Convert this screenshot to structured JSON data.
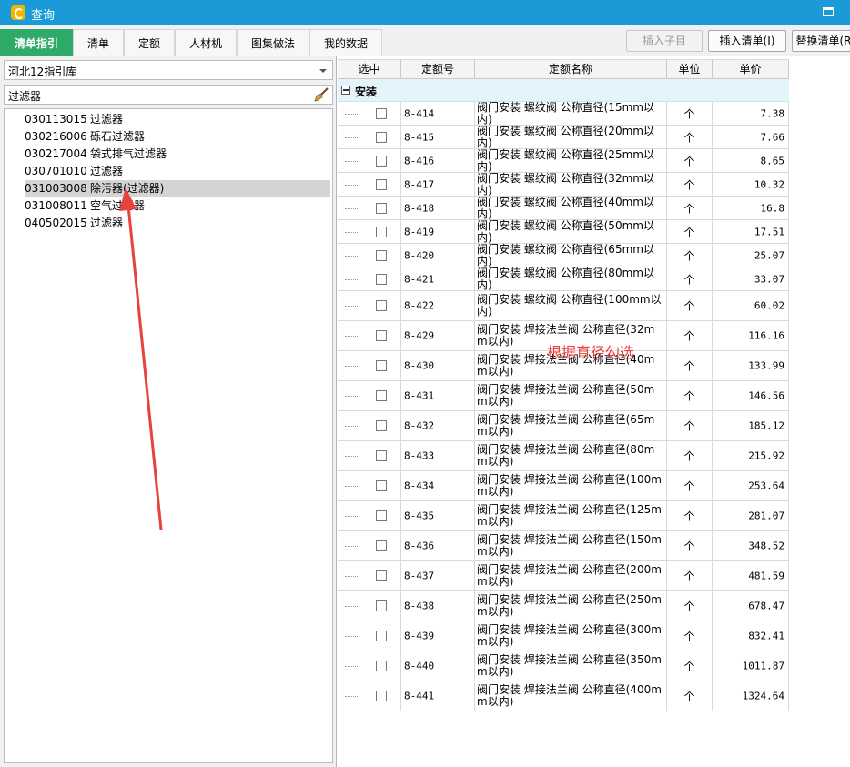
{
  "window": {
    "title": "查询",
    "accent": "#1a9bd7"
  },
  "tabs": [
    "清单指引",
    "清单",
    "定额",
    "人材机",
    "图集做法",
    "我的数据"
  ],
  "toolbar": {
    "insert_child": "插入子目",
    "insert_list": "插入清单(I)",
    "replace_list": "替换清单(R"
  },
  "left": {
    "library": "河北12指引库",
    "search_value": "过滤器",
    "tree": [
      {
        "code": "030113015",
        "name": "过滤器"
      },
      {
        "code": "030216006",
        "name": "砾石过滤器"
      },
      {
        "code": "030217004",
        "name": "袋式排气过滤器"
      },
      {
        "code": "030701010",
        "name": "过滤器"
      },
      {
        "code": "031003008",
        "name": "除污器(过滤器)",
        "selected": true
      },
      {
        "code": "031008011",
        "name": "空气过滤器"
      },
      {
        "code": "040502015",
        "name": "过滤器"
      }
    ]
  },
  "table": {
    "headers": [
      "选中",
      "定额号",
      "定额名称",
      "单位",
      "单价"
    ],
    "group": "安装",
    "rows": [
      {
        "code": "8-414",
        "name": "阀门安装 螺纹阀 公称直径(15mm以内)",
        "unit": "个",
        "price": "7.38"
      },
      {
        "code": "8-415",
        "name": "阀门安装 螺纹阀 公称直径(20mm以内)",
        "unit": "个",
        "price": "7.66"
      },
      {
        "code": "8-416",
        "name": "阀门安装 螺纹阀 公称直径(25mm以内)",
        "unit": "个",
        "price": "8.65"
      },
      {
        "code": "8-417",
        "name": "阀门安装 螺纹阀 公称直径(32mm以内)",
        "unit": "个",
        "price": "10.32"
      },
      {
        "code": "8-418",
        "name": "阀门安装 螺纹阀 公称直径(40mm以内)",
        "unit": "个",
        "price": "16.8"
      },
      {
        "code": "8-419",
        "name": "阀门安装 螺纹阀 公称直径(50mm以内)",
        "unit": "个",
        "price": "17.51"
      },
      {
        "code": "8-420",
        "name": "阀门安装 螺纹阀 公称直径(65mm以内)",
        "unit": "个",
        "price": "25.07"
      },
      {
        "code": "8-421",
        "name": "阀门安装 螺纹阀 公称直径(80mm以内)",
        "unit": "个",
        "price": "33.07"
      },
      {
        "code": "8-422",
        "name": "阀门安装 螺纹阀 公称直径(100mm以内)",
        "unit": "个",
        "price": "60.02"
      },
      {
        "code": "8-429",
        "name": "阀门安装 焊接法兰阀 公称直径(32mm以内)",
        "unit": "个",
        "price": "116.16"
      },
      {
        "code": "8-430",
        "name": "阀门安装 焊接法兰阀 公称直径(40mm以内)",
        "unit": "个",
        "price": "133.99"
      },
      {
        "code": "8-431",
        "name": "阀门安装 焊接法兰阀 公称直径(50mm以内)",
        "unit": "个",
        "price": "146.56"
      },
      {
        "code": "8-432",
        "name": "阀门安装 焊接法兰阀 公称直径(65mm以内)",
        "unit": "个",
        "price": "185.12"
      },
      {
        "code": "8-433",
        "name": "阀门安装 焊接法兰阀 公称直径(80mm以内)",
        "unit": "个",
        "price": "215.92"
      },
      {
        "code": "8-434",
        "name": "阀门安装 焊接法兰阀 公称直径(100mm以内)",
        "unit": "个",
        "price": "253.64"
      },
      {
        "code": "8-435",
        "name": "阀门安装 焊接法兰阀 公称直径(125mm以内)",
        "unit": "个",
        "price": "281.07"
      },
      {
        "code": "8-436",
        "name": "阀门安装 焊接法兰阀 公称直径(150mm以内)",
        "unit": "个",
        "price": "348.52"
      },
      {
        "code": "8-437",
        "name": "阀门安装 焊接法兰阀 公称直径(200mm以内)",
        "unit": "个",
        "price": "481.59"
      },
      {
        "code": "8-438",
        "name": "阀门安装 焊接法兰阀 公称直径(250mm以内)",
        "unit": "个",
        "price": "678.47"
      },
      {
        "code": "8-439",
        "name": "阀门安装 焊接法兰阀 公称直径(300mm以内)",
        "unit": "个",
        "price": "832.41"
      },
      {
        "code": "8-440",
        "name": "阀门安装 焊接法兰阀 公称直径(350mm以内)",
        "unit": "个",
        "price": "1011.87"
      },
      {
        "code": "8-441",
        "name": "阀门安装 焊接法兰阀 公称直径(400mm以内)",
        "unit": "个",
        "price": "1324.64"
      }
    ]
  },
  "annotation": {
    "text": "根据直径勾选",
    "color": "#e8423d"
  }
}
